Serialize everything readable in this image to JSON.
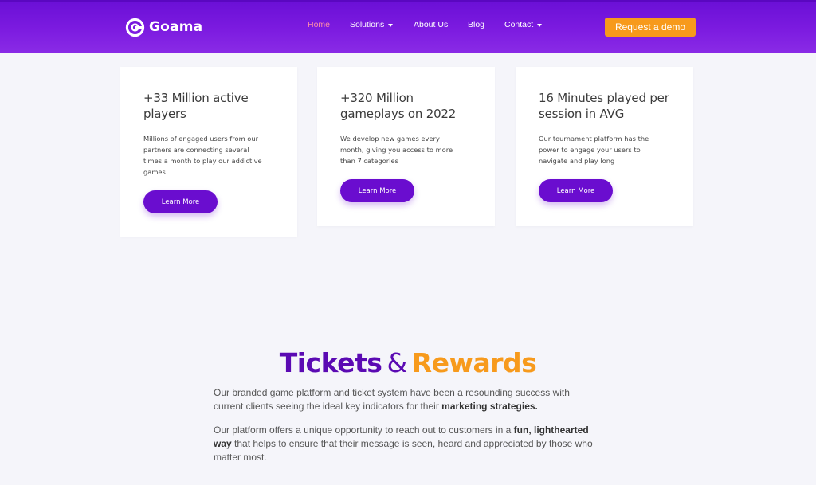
{
  "brand": {
    "name": "Goama"
  },
  "nav": {
    "items": [
      {
        "label": "Home",
        "active": true,
        "dropdown": false
      },
      {
        "label": "Solutions",
        "active": false,
        "dropdown": true
      },
      {
        "label": "About Us",
        "active": false,
        "dropdown": false
      },
      {
        "label": "Blog",
        "active": false,
        "dropdown": false
      },
      {
        "label": "Contact",
        "active": false,
        "dropdown": true
      }
    ],
    "cta_label": "Request a demo"
  },
  "cards": [
    {
      "title_line1": "+33 Million active",
      "title_line2": "players",
      "desc_lines": [
        "Millions of engaged users from our",
        "partners are connecting several",
        "times a month to play our addictive",
        "games"
      ],
      "button_label": "Learn More"
    },
    {
      "title_line1": "+320 Million",
      "title_line2": "gameplays on 2022",
      "desc_lines": [
        "We develop new games every",
        "month, giving you access to more",
        "than 7 categories"
      ],
      "button_label": "Learn More"
    },
    {
      "title_line1": "16 Minutes played per",
      "title_line2": "session in AVG",
      "desc_lines": [
        "Our tournament platform has the",
        "power to engage your users to",
        "navigate and play long"
      ],
      "button_label": "Learn More"
    }
  ],
  "section": {
    "title_part1": "Tickets",
    "title_amp": "&",
    "title_part2": "Rewards",
    "para1_line1": "Our branded game platform and ticket system have been a resounding success with",
    "para1_line2_plain": "current clients seeing the ideal key indicators for their ",
    "para1_line2_bold": "marketing strategies.",
    "para2_line1_plain": "Our platform offers a unique opportunity to reach out to customers in a ",
    "para2_line1_bold": "fun, lighthearted",
    "para2_line2_bold": "way",
    "para2_line2_plain": " that helps to ensure that their message is seen, heard and appreciated by those who",
    "para2_line3": "matter most."
  },
  "colors": {
    "header_purple": "#7c1be0",
    "button_purple": "#6a0dcf",
    "accent_orange": "#f79a1c",
    "nav_active": "#ff8fa8",
    "page_bg": "#f5f5fa"
  }
}
